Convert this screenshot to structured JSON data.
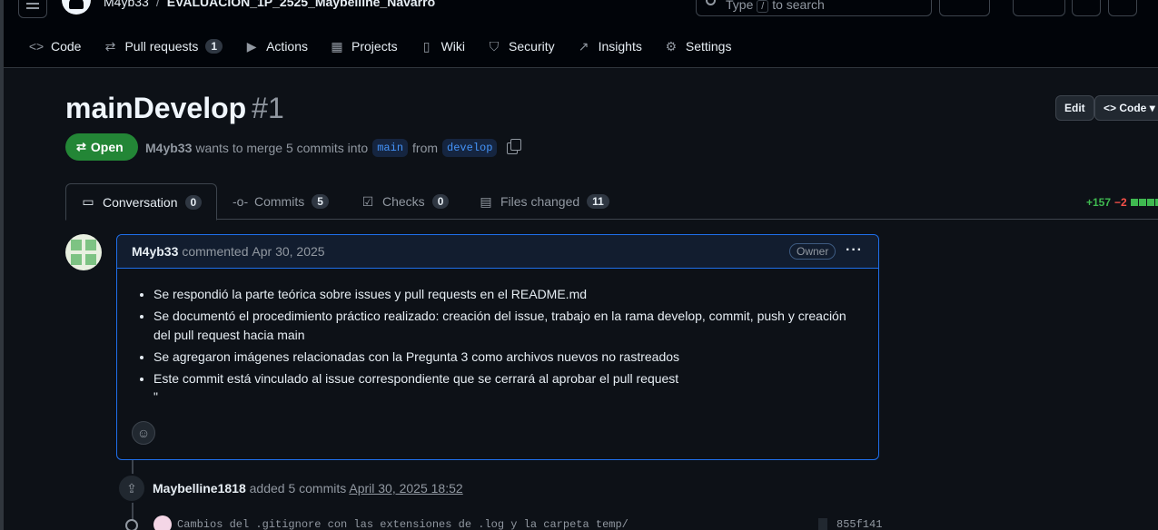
{
  "header": {
    "owner": "M4yb33",
    "separator": "/",
    "repo": "EVALUACION_1P_2525_Maybelline_Navarro",
    "search_pre": "Type",
    "search_key": "/",
    "search_post": "to search"
  },
  "repo_tabs": [
    {
      "label": "Code",
      "icon": "code-icon"
    },
    {
      "label": "Pull requests",
      "icon": "pull-request-icon",
      "count": "1"
    },
    {
      "label": "Actions",
      "icon": "play-icon"
    },
    {
      "label": "Projects",
      "icon": "table-icon"
    },
    {
      "label": "Wiki",
      "icon": "book-icon"
    },
    {
      "label": "Security",
      "icon": "shield-icon"
    },
    {
      "label": "Insights",
      "icon": "graph-icon"
    },
    {
      "label": "Settings",
      "icon": "gear-icon"
    }
  ],
  "pr": {
    "title": "mainDevelop",
    "number": "#1",
    "state": "Open",
    "author": "M4yb33",
    "merge_text": "wants to merge 5 commits into",
    "base": "main",
    "from": "from",
    "head": "develop",
    "edit_label": "Edit",
    "code_label": "Code"
  },
  "pr_tabs": [
    {
      "label": "Conversation",
      "count": "0"
    },
    {
      "label": "Commits",
      "count": "5"
    },
    {
      "label": "Checks",
      "count": "0"
    },
    {
      "label": "Files changed",
      "count": "11"
    }
  ],
  "diffstat": {
    "additions": "+157",
    "deletions": "−2"
  },
  "comment": {
    "author": "M4yb33",
    "action": "commented",
    "date": "Apr 30, 2025",
    "role": "Owner",
    "items": [
      "Se respondió la parte teórica sobre issues y pull requests en el README.md",
      "Se documentó el procedimiento práctico realizado: creación del issue, trabajo en la rama develop, commit, push y creación del pull request hacia main",
      "Se agregaron imágenes relacionadas con la Pregunta 3 como archivos nuevos no rastreados",
      "Este commit está vinculado al issue correspondiente que se cerrará al aprobar el pull request"
    ],
    "trailing": "\""
  },
  "timeline": {
    "author": "Maybelline1818",
    "action": "added 5 commits",
    "date": "April 30, 2025 18:52",
    "commit_message": "Cambios del .gitignore con las extensiones de .log y la carpeta temp/",
    "commit_sha": "855f141"
  },
  "colors": {
    "accent": "#1f6feb",
    "open_green": "#238636",
    "addition": "#3fb950",
    "deletion": "#f85149"
  }
}
